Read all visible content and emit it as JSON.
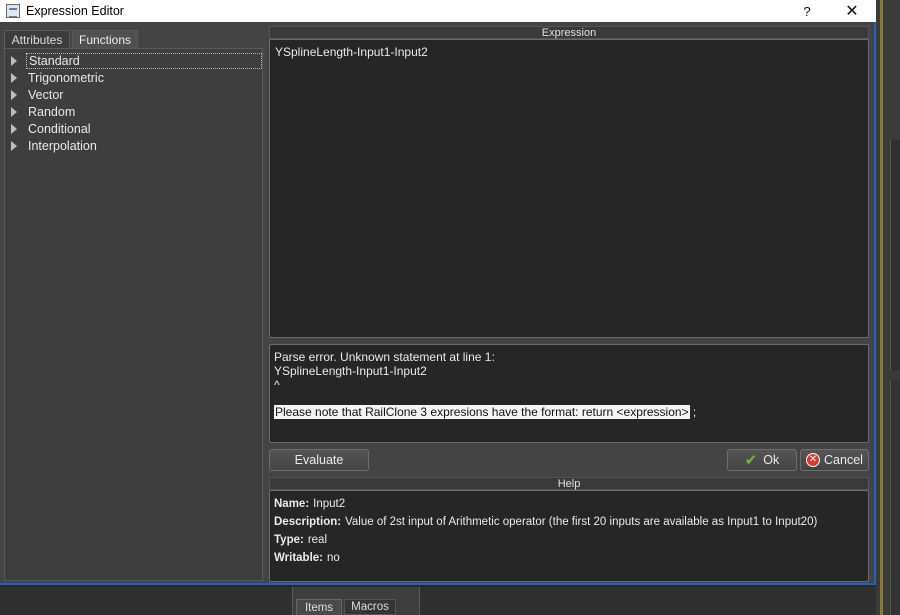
{
  "window": {
    "title": "Expression Editor",
    "help_glyph": "?",
    "close_glyph": "✕"
  },
  "left_tabs": [
    {
      "label": "Attributes"
    },
    {
      "label": "Functions"
    }
  ],
  "tree": {
    "items": [
      {
        "label": "Standard"
      },
      {
        "label": "Trigonometric"
      },
      {
        "label": "Vector"
      },
      {
        "label": "Random"
      },
      {
        "label": "Conditional"
      },
      {
        "label": "Interpolation"
      }
    ]
  },
  "expression": {
    "header": "Expression",
    "text": "YSplineLength-Input1-Input2"
  },
  "error": {
    "line1": "Parse error. Unknown statement at line 1:",
    "line2": "YSplineLength-Input1-Input2",
    "line3": "^",
    "note_highlight": "Please note that RailClone 3 expresions have the format: return <expression>",
    "note_tail": " ;"
  },
  "buttons": {
    "evaluate": "Evaluate",
    "ok": "Ok",
    "cancel": "Cancel"
  },
  "help": {
    "header": "Help",
    "rows": [
      {
        "key": "Name:",
        "value": "Input2"
      },
      {
        "key": "Description:",
        "value": "Value of 2st input of Arithmetic operator (the first 20 inputs are available as Input1 to Input20)"
      },
      {
        "key": "Type:",
        "value": "real"
      },
      {
        "key": "Writable:",
        "value": "no"
      }
    ]
  },
  "bottom_tabs": [
    {
      "label": "Items"
    },
    {
      "label": "Macros"
    }
  ],
  "colors": {
    "frame_accent": "#2160c4",
    "ok_check": "#63c437",
    "cancel_icon": "#d83a2b"
  }
}
